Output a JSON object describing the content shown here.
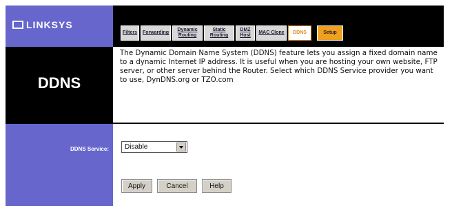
{
  "brand": {
    "name": "LINKSYS"
  },
  "tabs": [
    {
      "label": "Filters"
    },
    {
      "label": "Forwarding"
    },
    {
      "label": "Dynamic Routing"
    },
    {
      "label": "Static Routing"
    },
    {
      "label": "DMZ Host"
    },
    {
      "label": "MAC Clone"
    },
    {
      "label": "DDNS",
      "active": true
    },
    {
      "label": "Setup"
    }
  ],
  "page": {
    "title": "DDNS",
    "description": "The Dynamic Domain Name System (DDNS) feature lets you assign a fixed domain name to a dynamic Internet IP address. It is useful when you are hosting your own website, FTP server, or other server behind the Router. Select which DDNS Service provider you want to use, DynDNS.org or TZO.com"
  },
  "form": {
    "service_label": "DDNS Service:",
    "service_value": "Disable"
  },
  "buttons": {
    "apply": "Apply",
    "cancel": "Cancel",
    "help": "Help"
  },
  "colors": {
    "brand_purple": "#6666cc",
    "header_black": "#000000",
    "tab_active": "#e08a1e",
    "tab_setup": "#f0a020"
  }
}
